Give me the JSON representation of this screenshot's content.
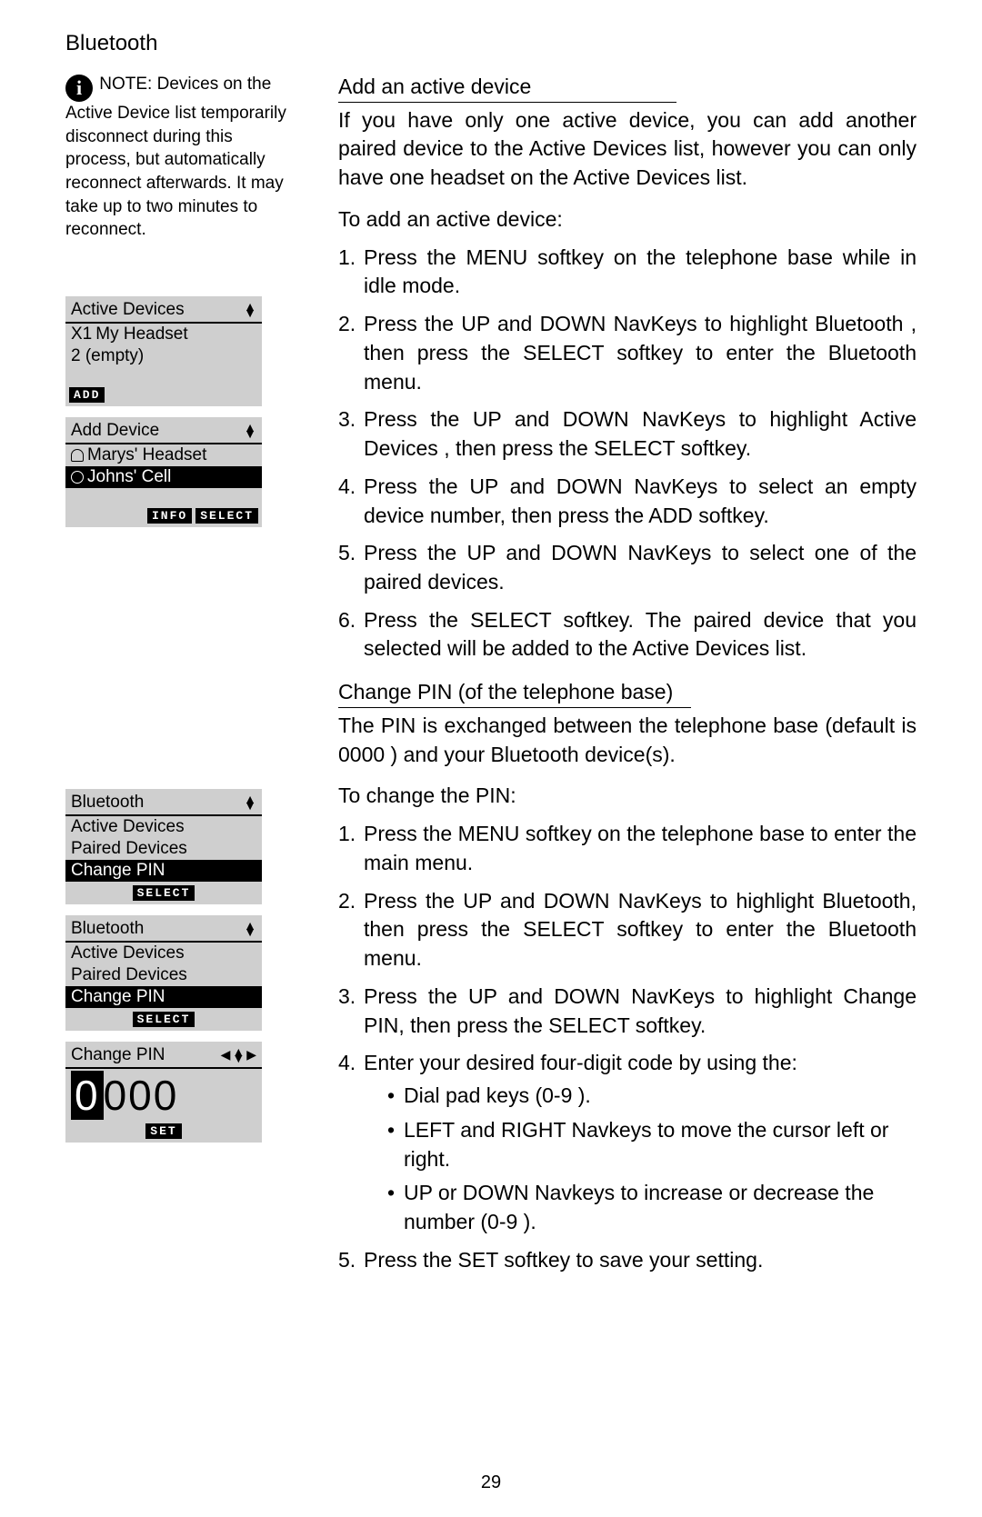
{
  "page": {
    "title": "Bluetooth",
    "number": "29"
  },
  "note": {
    "label": "NOTE:",
    "text": "Devices on the Active Device list temporarily disconnect during this process, but automatically reconnect afterwards. It may take up to two minutes to reconnect."
  },
  "lcd1": {
    "title": "Active Devices",
    "row1a": "X1",
    "row1b": "My Headset",
    "row2": " 2 (empty)",
    "softkey": "ADD"
  },
  "lcd2": {
    "title": "Add Device",
    "row1": "Marys' Headset",
    "row2": "Johns' Cell",
    "softkey1": "INFO",
    "softkey2": "SELECT"
  },
  "lcd3": {
    "title": "Bluetooth",
    "row1": "Active Devices",
    "row2": "Paired Devices",
    "row3": "Change PIN",
    "softkey": "SELECT"
  },
  "lcd4": {
    "title": "Bluetooth",
    "row1": "Active Devices",
    "row2": "Paired Devices",
    "row3": "Change PIN",
    "softkey": "SELECT"
  },
  "lcd5": {
    "title": "Change PIN",
    "first": "0",
    "rest": "000",
    "softkey": "SET"
  },
  "sectionA": {
    "title": "Add an active device",
    "para": "If you have only one active device, you can add another paired device to the Active Devices list, however you can only have one headset on the Active Devices list.",
    "intro": "To add an active device:",
    "steps": [
      "Press the MENU softkey on the telephone base while in idle mode.",
      "Press the UP and DOWN NavKeys to highlight Bluetooth , then press the SELECT softkey to enter the Bluetooth  menu.",
      "Press the UP and DOWN NavKeys to highlight Active Devices , then press the SELECT softkey.",
      "Press the UP and DOWN NavKeys to select an empty device number, then press the ADD softkey.",
      "Press the UP and DOWN NavKeys to select one of the paired devices.",
      "Press the SELECT softkey. The paired device that you selected will be added to the Active Devices list."
    ]
  },
  "sectionB": {
    "title": "Change PIN (of the telephone base)",
    "para": "The PIN is exchanged between the telephone base (default is 0000 ) and your Bluetooth device(s).",
    "intro": "To change the PIN:",
    "steps": [
      "Press the MENU softkey on the telephone base to enter the main menu.",
      "Press the UP and DOWN NavKeys to highlight Bluetooth, then press the SELECT softkey to enter the Bluetooth  menu.",
      "Press the UP and DOWN NavKeys to highlight Change PIN, then press the SELECT softkey.",
      "Enter your desired four-digit code by using the:",
      "Press the SET softkey to save your setting."
    ],
    "bullets": [
      "Dial pad keys (0-9 ).",
      "LEFT and RIGHT Navkeys to move the cursor left or right.",
      "UP or DOWN Navkeys to increase or decrease the number (0-9 )."
    ]
  }
}
